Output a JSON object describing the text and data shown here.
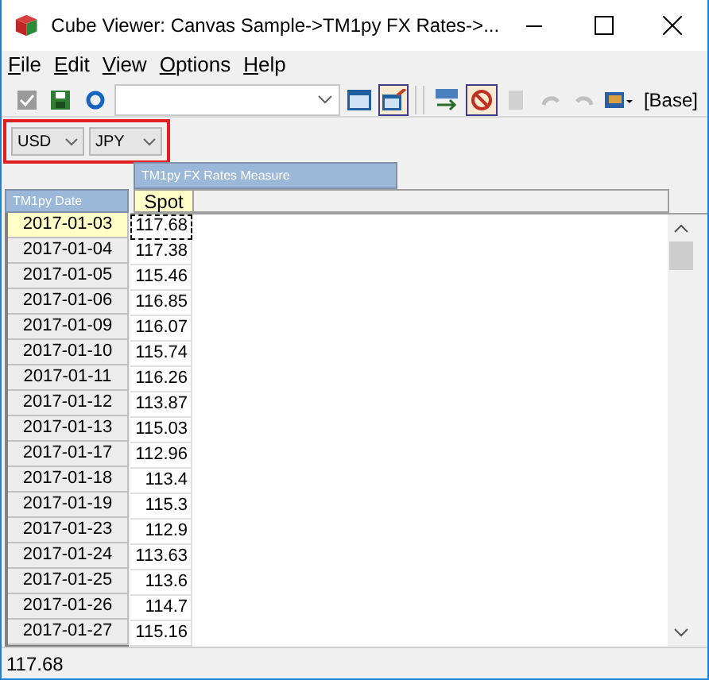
{
  "window": {
    "title": "Cube Viewer: Canvas Sample->TM1py FX Rates->..."
  },
  "menu": [
    {
      "label": "File",
      "first_letter_underlined": true
    },
    {
      "label": "Edit",
      "first_letter_underlined": true
    },
    {
      "label": "View",
      "first_letter_underlined": true
    },
    {
      "label": "Options",
      "first_letter_underlined": true
    },
    {
      "label": "Help",
      "first_letter_underlined": true
    }
  ],
  "toolbar": {
    "view_label": "[Base]"
  },
  "title_dimensions": [
    {
      "value": "USD"
    },
    {
      "value": "JPY"
    }
  ],
  "column_dimension": {
    "name": "TM1py FX Rates Measure",
    "members": [
      "Spot"
    ]
  },
  "row_dimension": {
    "name": "TM1py Date"
  },
  "rows": [
    {
      "label": "2017-01-03",
      "value": "117.68",
      "selected": true
    },
    {
      "label": "2017-01-04",
      "value": "117.38",
      "selected": false
    },
    {
      "label": "2017-01-05",
      "value": "115.46",
      "selected": false
    },
    {
      "label": "2017-01-06",
      "value": "116.85",
      "selected": false
    },
    {
      "label": "2017-01-09",
      "value": "116.07",
      "selected": false
    },
    {
      "label": "2017-01-10",
      "value": "115.74",
      "selected": false
    },
    {
      "label": "2017-01-11",
      "value": "116.26",
      "selected": false
    },
    {
      "label": "2017-01-12",
      "value": "113.87",
      "selected": false
    },
    {
      "label": "2017-01-13",
      "value": "115.03",
      "selected": false
    },
    {
      "label": "2017-01-17",
      "value": "112.96",
      "selected": false
    },
    {
      "label": "2017-01-18",
      "value": "113.4",
      "selected": false
    },
    {
      "label": "2017-01-19",
      "value": "115.3",
      "selected": false
    },
    {
      "label": "2017-01-23",
      "value": "112.9",
      "selected": false
    },
    {
      "label": "2017-01-24",
      "value": "113.63",
      "selected": false
    },
    {
      "label": "2017-01-25",
      "value": "113.6",
      "selected": false
    },
    {
      "label": "2017-01-26",
      "value": "114.7",
      "selected": false
    },
    {
      "label": "2017-01-27",
      "value": "115.16",
      "selected": false
    }
  ],
  "status_bar": {
    "text": "117.68"
  }
}
